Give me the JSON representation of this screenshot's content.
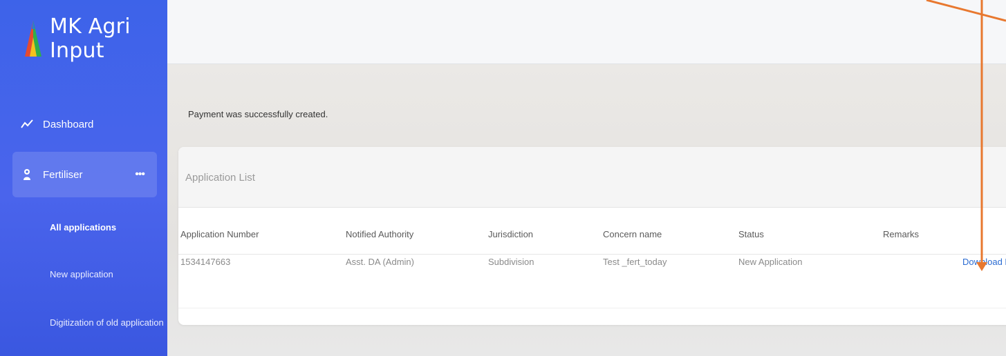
{
  "app": {
    "title": "MK Agri Input"
  },
  "sidebar": {
    "items": [
      {
        "label": "Dashboard",
        "icon": "activity-icon"
      },
      {
        "label": "Fertiliser",
        "icon": "seedling-icon",
        "more": "•••"
      }
    ],
    "subitems": [
      {
        "label": "All applications"
      },
      {
        "label": "New application"
      },
      {
        "label": "Digitization of old application"
      }
    ]
  },
  "main": {
    "message": "Payment was successfully created.",
    "card_title": "Application List",
    "columns": [
      "Application Number",
      "Notified Authority",
      "Jurisdiction",
      "Concern name",
      "Status",
      "Remarks"
    ],
    "rows": [
      {
        "application_number": "1534147663",
        "notified_authority": "Asst. DA (Admin)",
        "jurisdiction": "Subdivision",
        "concern_name": "Test _fert_today",
        "status": "New Application",
        "remarks": "",
        "action": "Download PD"
      }
    ]
  },
  "colors": {
    "sidebar": "#3d63e9",
    "link": "#2a6bd2",
    "annotation": "#e8782f"
  }
}
